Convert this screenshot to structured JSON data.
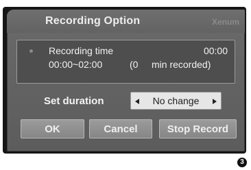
{
  "dialog": {
    "title": "Recording Option",
    "hint": "Xenum"
  },
  "recording": {
    "label": "Recording time",
    "time": "00:00",
    "range": "00:00~02:00",
    "minutes_recorded": "(0",
    "suffix": "min recorded)"
  },
  "duration": {
    "label": "Set duration",
    "value": "No change"
  },
  "buttons": {
    "ok": "OK",
    "cancel": "Cancel",
    "stop": "Stop Record"
  },
  "badge": "3"
}
